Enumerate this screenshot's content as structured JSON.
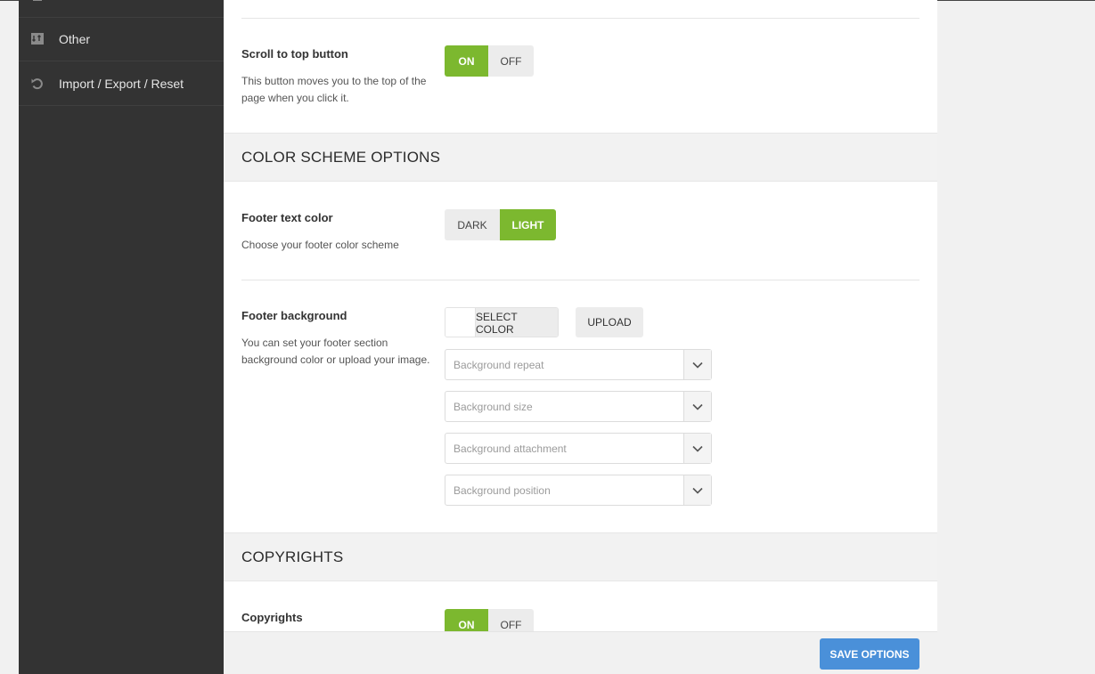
{
  "sidebar": {
    "items": [
      {
        "label": "",
        "icon": "list-icon"
      },
      {
        "label": "Other",
        "icon": "other-icon"
      },
      {
        "label": "Import / Export / Reset",
        "icon": "reset-icon"
      }
    ]
  },
  "options": {
    "scroll_top": {
      "title": "Scroll to top button",
      "desc": "This button moves you to the top of the page when you click it.",
      "on_label": "ON",
      "off_label": "OFF",
      "state": "on"
    },
    "color_scheme_section": "COLOR SCHEME OPTIONS",
    "footer_text_color": {
      "title": "Footer text color",
      "desc": "Choose your footer color scheme",
      "dark_label": "DARK",
      "light_label": "LIGHT",
      "state": "light"
    },
    "footer_background": {
      "title": "Footer background",
      "desc": "You can set your footer section background color or upload your image.",
      "select_color_label": "SELECT COLOR",
      "upload_label": "UPLOAD",
      "selects": [
        {
          "placeholder": "Background repeat"
        },
        {
          "placeholder": "Background size"
        },
        {
          "placeholder": "Background attachment"
        },
        {
          "placeholder": "Background position"
        }
      ]
    },
    "copyrights_section": "COPYRIGHTS",
    "copyrights": {
      "title": "Copyrights",
      "on_label": "ON",
      "off_label": "OFF",
      "state": "on"
    }
  },
  "footer": {
    "save_label": "SAVE OPTIONS"
  },
  "colors": {
    "accent_green": "#7cb82f",
    "save_blue": "#4a90d9",
    "sidebar_bg": "#333333"
  }
}
